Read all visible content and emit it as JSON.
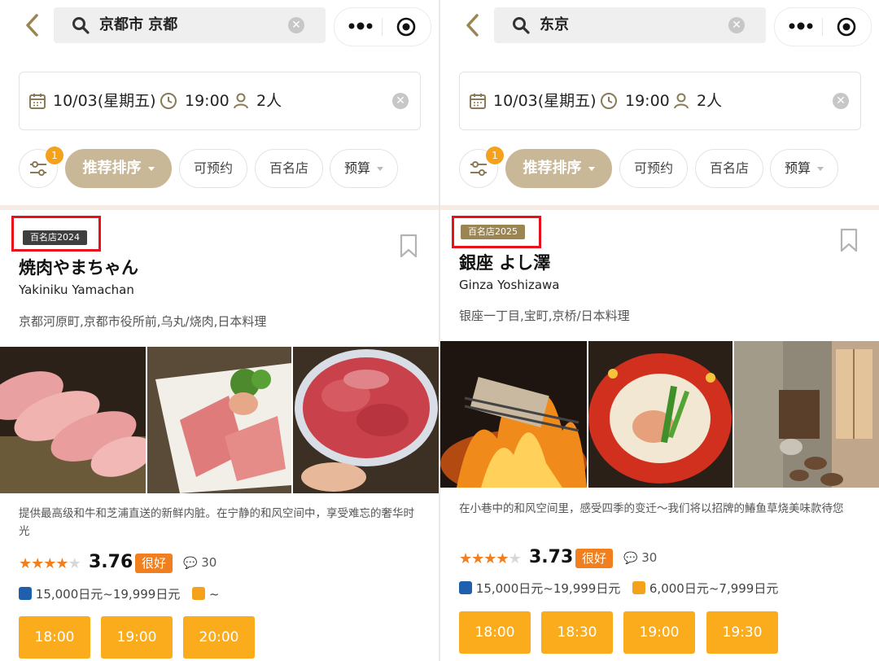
{
  "panels": [
    {
      "search_text": "京都市 京都",
      "date": "10/03(星期五)",
      "time": "19:00",
      "guests": "2人",
      "filter_badge": "1",
      "filters": [
        "推荐排序",
        "可预约",
        "百名店",
        "预算"
      ],
      "restaurant": {
        "award": "百名店2024",
        "award_color": "#3f3f3f",
        "name": "焼肉やまちゃん",
        "roman": "Yakiniku Yamachan",
        "location": "京都河原町,京都市役所前,乌丸/烧肉,日本料理",
        "description": "提供最高级和牛和芝浦直送的新鲜内脏。在宁静的和风空间中，享受难忘的奢华时光",
        "stars": 3.5,
        "score": "3.76",
        "tag": "很好",
        "reviews": "30",
        "dinner_budget": "15,000日元~19,999日元",
        "lunch_budget": "~",
        "times": [
          "18:00",
          "19:00",
          "20:00"
        ]
      }
    },
    {
      "search_text": "东京",
      "date": "10/03(星期五)",
      "time": "19:00",
      "guests": "2人",
      "filter_badge": "1",
      "filters": [
        "推荐排序",
        "可预约",
        "百名店",
        "预算"
      ],
      "restaurant": {
        "award": "百名店2025",
        "award_color": "#9b8553",
        "name": "銀座 よし澤",
        "roman": "Ginza Yoshizawa",
        "location": "银座一丁目,宝町,京桥/日本料理",
        "description": "在小巷中的和风空间里，感受四季的变迁～我们将以招牌的鰆鱼草烧美味款待您",
        "stars": 3.5,
        "score": "3.73",
        "tag": "很好",
        "reviews": "30",
        "dinner_budget": "15,000日元~19,999日元",
        "lunch_budget": "6,000日元~7,999日元",
        "times": [
          "18:00",
          "18:30",
          "19:00",
          "19:30"
        ]
      }
    }
  ],
  "colors": {
    "gold": "#c9b898",
    "accent_orange": "#f07f1f",
    "slot_orange": "#fbac1d",
    "highlight_red": "#e8101b"
  }
}
